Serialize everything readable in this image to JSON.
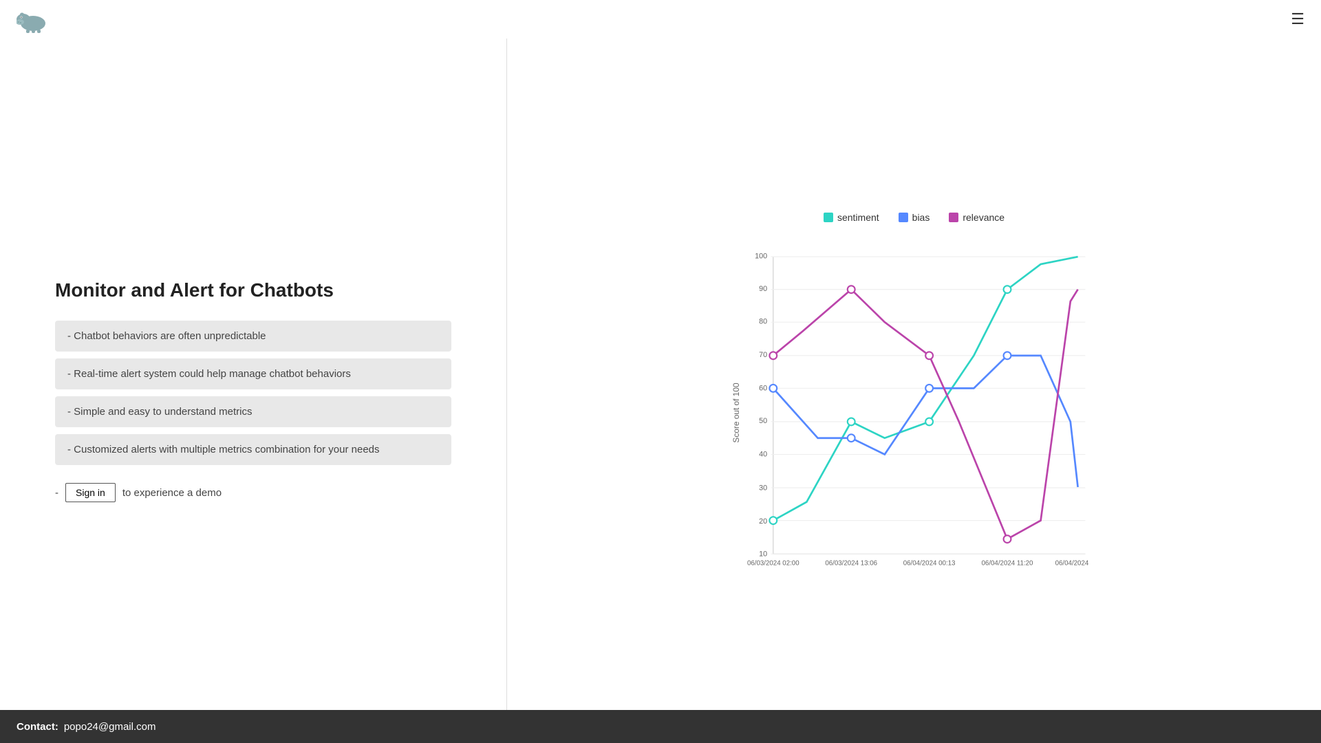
{
  "header": {
    "hamburger_label": "☰"
  },
  "left": {
    "title": "Monitor and Alert for Chatbots",
    "features": [
      "- Chatbot behaviors are often unpredictable",
      "- Real-time alert system could help manage chatbot behaviors",
      "- Simple and easy to understand metrics",
      "- Customized alerts with multiple metrics combination for your needs"
    ],
    "signin_label": "Sign in",
    "signin_suffix": "to experience a demo"
  },
  "chart": {
    "legend": [
      {
        "label": "sentiment",
        "color": "#2dd4c4"
      },
      {
        "label": "bias",
        "color": "#5588ff"
      },
      {
        "label": "relevance",
        "color": "#bb44aa"
      }
    ],
    "y_axis_label": "Score out of 100",
    "x_labels": [
      "06/03/2024 02:00",
      "06/03/2024 13:06",
      "06/04/2024 00:13",
      "06/04/2024 11:20",
      "06/04/2024"
    ],
    "y_ticks": [
      10,
      20,
      30,
      40,
      50,
      60,
      70,
      80,
      90,
      100
    ]
  },
  "footer": {
    "contact_label": "Contact:",
    "contact_email": "popo24@gmail.com"
  }
}
